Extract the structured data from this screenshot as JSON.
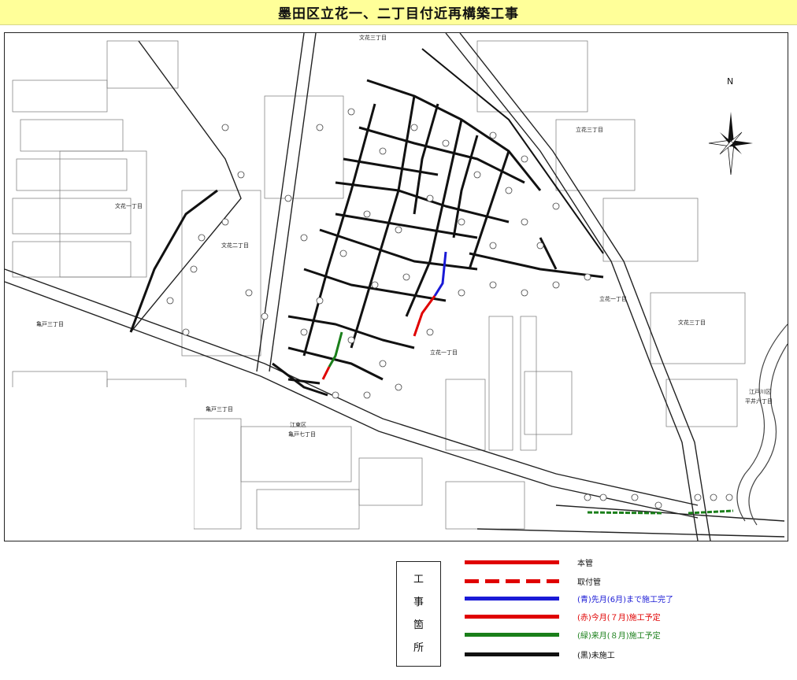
{
  "header": {
    "title": "墨田区立花一、二丁目付近再構築工事"
  },
  "map": {
    "north_label": "N",
    "areas": {
      "bunka_1": "文花一丁目",
      "bunka_2": "文花二丁目",
      "bunka_3": "文花三丁目",
      "tachibana_1": "立花一丁目",
      "tachibana_3": "立花三丁目",
      "kameido_3_a": "亀戸三丁目",
      "kameido_3_b": "亀戸三丁目",
      "kameido_7": "亀戸七丁目",
      "koto_ward": "江東区",
      "edogawa_ward": "江戸川区",
      "hirai_6": "平井六丁目",
      "tachibana_ichi": "立花一丁目"
    },
    "colors": {
      "main_pipe": "#e00000",
      "blue_done": "#1a1ad6",
      "red_this_month": "#e00000",
      "green_next_month": "#1a7f1a",
      "black_pending": "#111111"
    }
  },
  "legend": {
    "box_chars": [
      "工",
      "事",
      "箇",
      "所"
    ],
    "items": [
      {
        "label": "本管",
        "color": "#e00000",
        "style": "solid",
        "text_color": "#111111"
      },
      {
        "label": "取付管",
        "color": "#e00000",
        "style": "dashed",
        "text_color": "#111111"
      },
      {
        "label": "(青)先月(6月)まで施工完了",
        "color": "#1a1ad6",
        "style": "solid",
        "text_color": "#1a1ad6"
      },
      {
        "label": "(赤)今月(７月)施工予定",
        "color": "#e00000",
        "style": "solid",
        "text_color": "#e00000"
      },
      {
        "label": "(緑)来月(８月)施工予定",
        "color": "#1a7f1a",
        "style": "solid",
        "text_color": "#1a7f1a"
      },
      {
        "label": "(黒)未施工",
        "color": "#111111",
        "style": "solid",
        "text_color": "#111111"
      }
    ]
  }
}
